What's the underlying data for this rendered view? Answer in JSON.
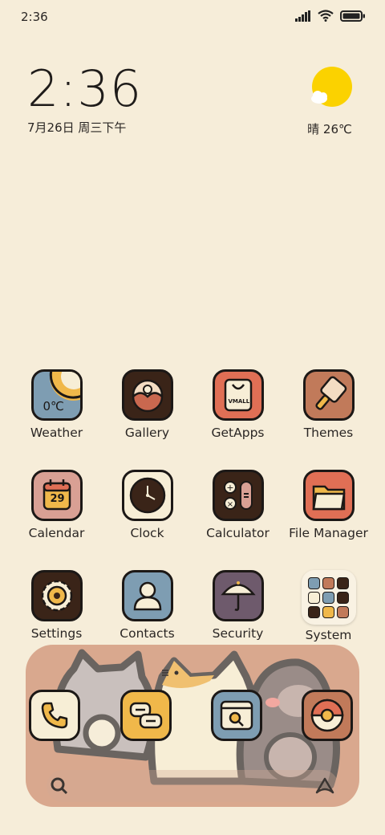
{
  "status_bar": {
    "time": "2:36"
  },
  "clock_widget": {
    "time": "2:36",
    "date": "7月26日 周三下午"
  },
  "weather_widget": {
    "text": "晴 26℃",
    "icon": "sun-with-cloud"
  },
  "apps": [
    {
      "label": "Weather",
      "icon": "weather-icon",
      "icon_text": "0℃"
    },
    {
      "label": "Gallery",
      "icon": "gallery-icon"
    },
    {
      "label": "GetApps",
      "icon": "getapps-bag-icon",
      "icon_text": "VMALL"
    },
    {
      "label": "Themes",
      "icon": "paintbrush-icon"
    },
    {
      "label": "Calendar",
      "icon": "calendar-icon",
      "icon_text": "29"
    },
    {
      "label": "Clock",
      "icon": "clock-icon"
    },
    {
      "label": "Calculator",
      "icon": "calculator-icon"
    },
    {
      "label": "File Manager",
      "icon": "folder-icon"
    },
    {
      "label": "Settings",
      "icon": "gear-icon"
    },
    {
      "label": "Contacts",
      "icon": "person-icon"
    },
    {
      "label": "Security",
      "icon": "umbrella-icon"
    },
    {
      "label": "System",
      "icon": "folder-grid-icon"
    }
  ],
  "dock": {
    "apps": [
      {
        "name": "Phone",
        "icon": "phone-icon"
      },
      {
        "name": "Messages",
        "icon": "chat-bubbles-icon"
      },
      {
        "name": "Browser",
        "icon": "browser-search-icon"
      },
      {
        "name": "Camera",
        "icon": "camera-icon"
      }
    ]
  },
  "colors": {
    "background": "#f6edd9",
    "outline": "#1c1816",
    "blue": "#7e9db2",
    "brown": "#3a2418",
    "orange_red": "#e06f55",
    "tan": "#c17a5a",
    "yellow": "#f0b84a",
    "purple": "#6e5a6c",
    "cream": "#f7eed6",
    "dock": "#d9a88e"
  }
}
